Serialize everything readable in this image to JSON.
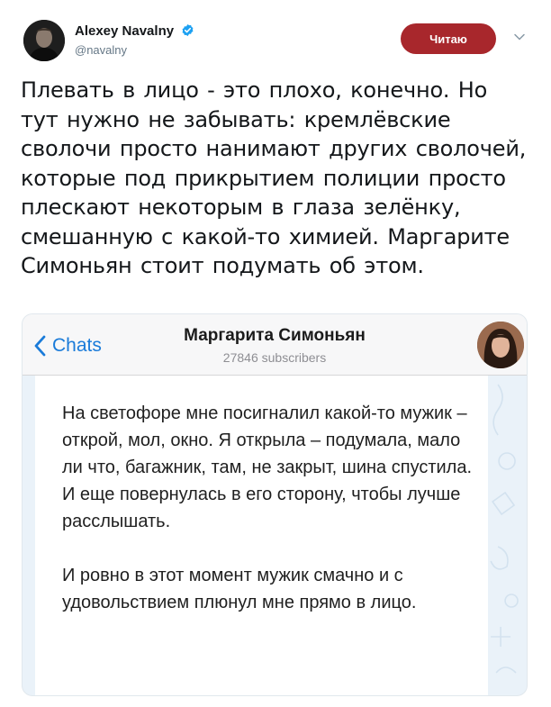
{
  "tweet": {
    "author_name": "Alexey Navalny",
    "author_handle": "@navalny",
    "follow_label": "Читаю",
    "text": "Плевать в лицо - это плохо, конечно. Но тут нужно не забывать: кремлёвские сволочи просто нанимают других сволочей, которые под прикрытием полиции просто плескают некоторым в глаза зелёнку, смешанную с какой-то химией. Маргарите Симоньян стоит подумать об этом."
  },
  "screenshot": {
    "back_label": "Chats",
    "channel_name": "Маргарита Симоньян",
    "subscribers": "27846 subscribers",
    "message": {
      "paragraph_1": "На светофоре мне посигналил какой-то мужик – открой, мол, окно. Я открыла – подумала, мало ли что, багажник, там, не закрыт, шина спустила. И еще повернулась в его сторону, чтобы лучше расслышать.",
      "paragraph_2": "И ровно в этот момент мужик смачно и с удовольствием плюнул мне прямо в лицо."
    }
  },
  "colors": {
    "follow_button": "#a8272c",
    "verified": "#1da1f2",
    "telegram_link": "#1a7bd9",
    "chat_background": "#eaf2f9"
  },
  "icons": [
    "verified-badge-icon",
    "caret-down-icon",
    "back-chevron-icon"
  ]
}
